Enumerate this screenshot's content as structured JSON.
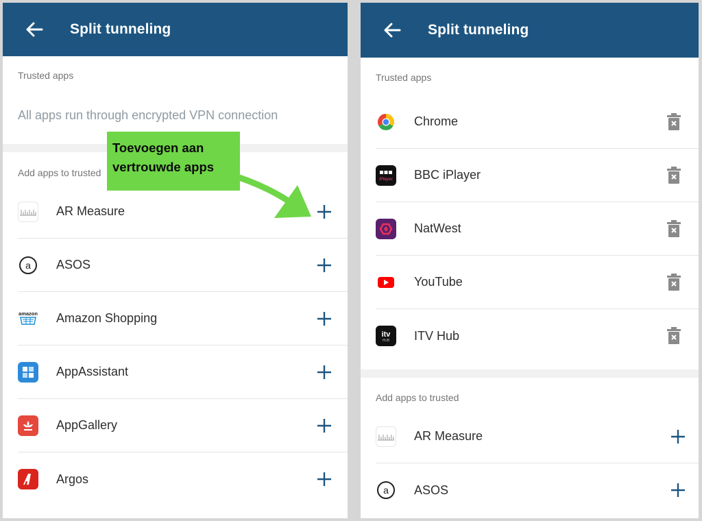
{
  "left_screen": {
    "header": {
      "title": "Split tunneling"
    },
    "trusted_label": "Trusted apps",
    "trusted_empty_note": "All apps run through encrypted VPN connection",
    "add_label": "Add apps to trusted",
    "apps": [
      {
        "name": "AR Measure",
        "icon": "ar-measure-icon"
      },
      {
        "name": "ASOS",
        "icon": "asos-icon"
      },
      {
        "name": "Amazon Shopping",
        "icon": "amazon-shopping-icon"
      },
      {
        "name": "AppAssistant",
        "icon": "appassistant-icon"
      },
      {
        "name": "AppGallery",
        "icon": "appgallery-icon"
      },
      {
        "name": "Argos",
        "icon": "argos-icon"
      }
    ]
  },
  "right_screen": {
    "header": {
      "title": "Split tunneling"
    },
    "trusted_label": "Trusted apps",
    "trusted_apps": [
      {
        "name": "Chrome",
        "icon": "chrome-icon"
      },
      {
        "name": "BBC iPlayer",
        "icon": "bbc-iplayer-icon"
      },
      {
        "name": "NatWest",
        "icon": "natwest-icon"
      },
      {
        "name": "YouTube",
        "icon": "youtube-icon"
      },
      {
        "name": "ITV Hub",
        "icon": "itv-hub-icon"
      }
    ],
    "add_label": "Add apps to trusted",
    "apps": [
      {
        "name": "AR Measure",
        "icon": "ar-measure-icon"
      },
      {
        "name": "ASOS",
        "icon": "asos-icon"
      }
    ]
  },
  "annotation": {
    "callout_line1": "Toevoegen aan",
    "callout_line2": "vertrouwde apps"
  },
  "colors": {
    "header": "#1d5580",
    "add_icon": "#1d5580",
    "delete_icon": "#8a8a8a",
    "callout": "#6fd647"
  }
}
